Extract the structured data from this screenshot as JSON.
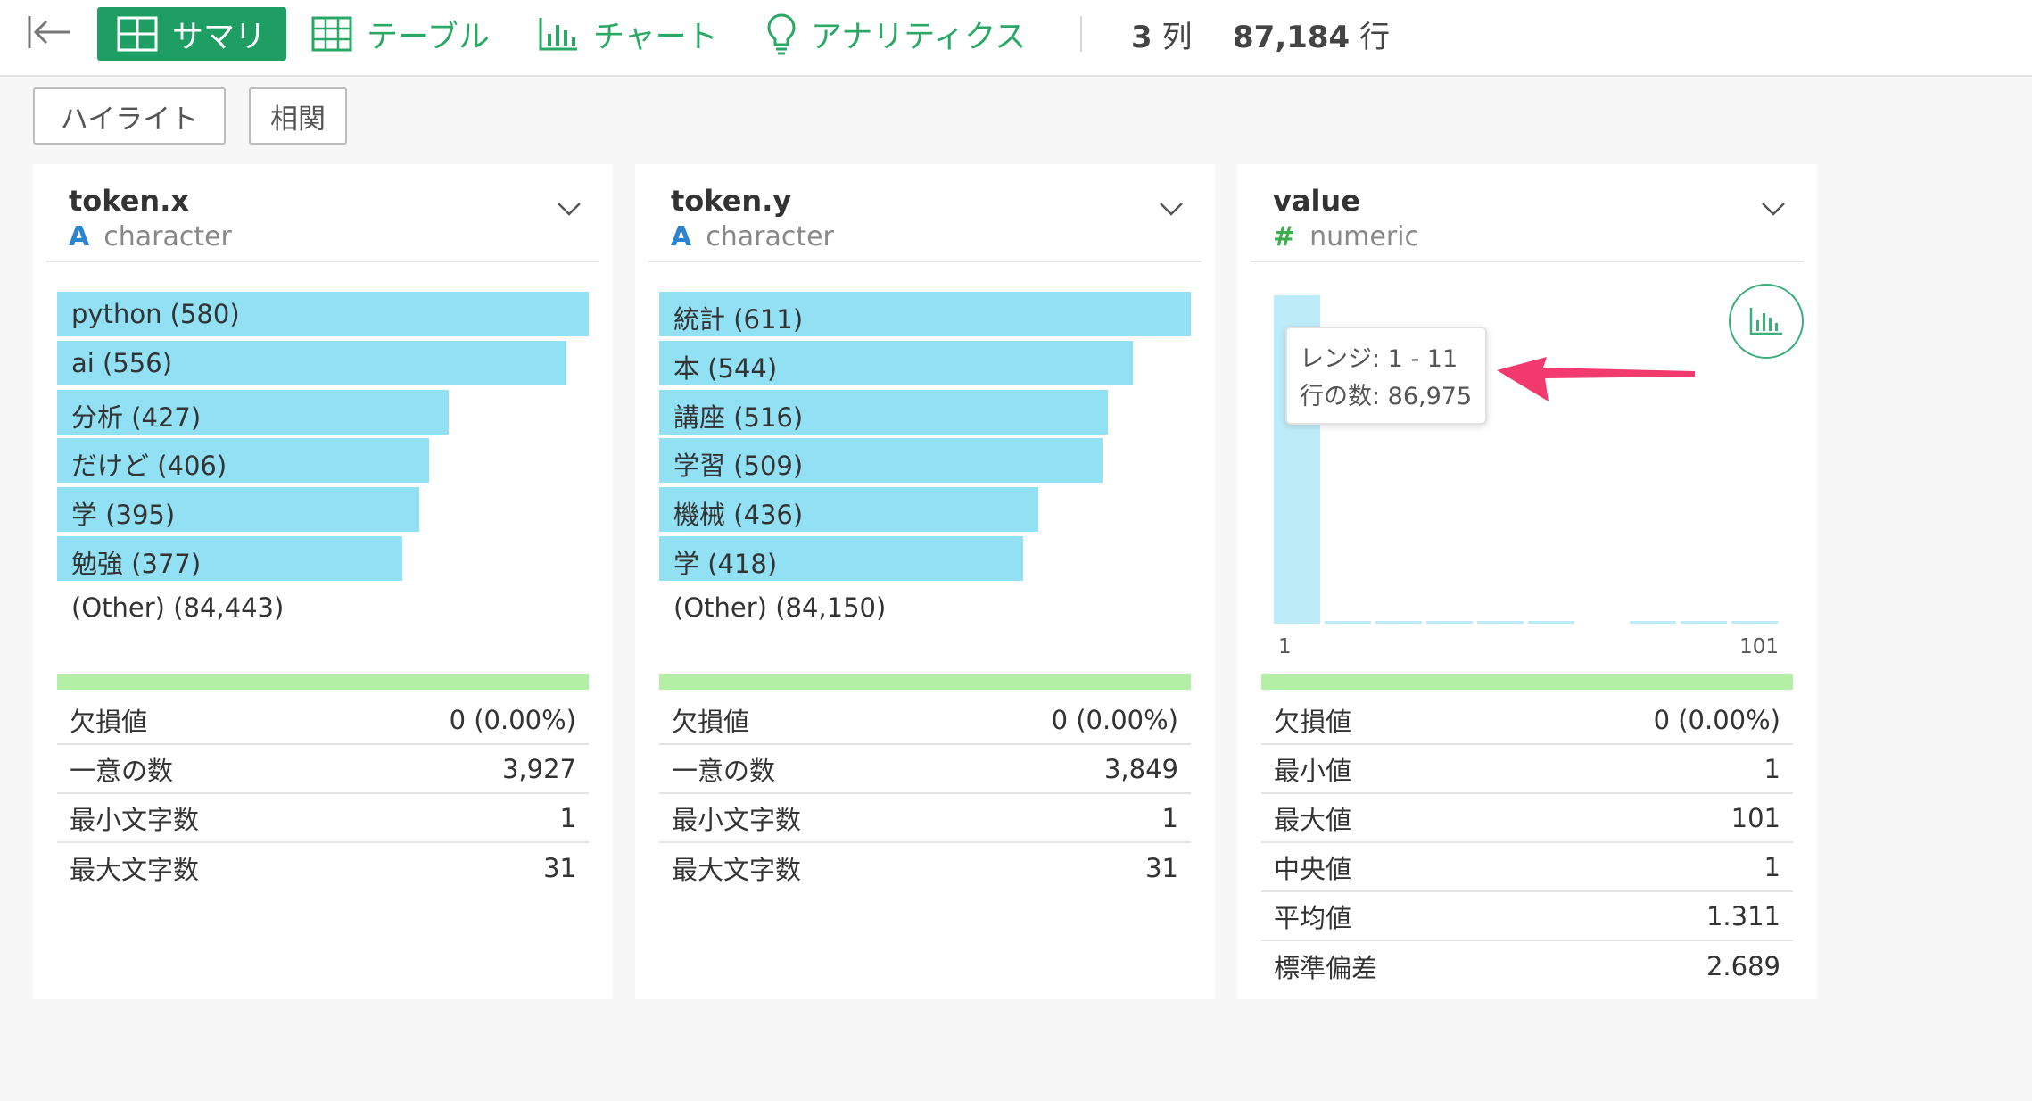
{
  "toolbar": {
    "tabs": [
      {
        "label": "サマリ",
        "icon": "grid-icon",
        "active": true
      },
      {
        "label": "テーブル",
        "icon": "table-icon",
        "active": false
      },
      {
        "label": "チャート",
        "icon": "bar-chart-icon",
        "active": false
      },
      {
        "label": "アナリティクス",
        "icon": "lightbulb-icon",
        "active": false
      }
    ],
    "columns_count": "3",
    "columns_unit": "列",
    "rows_count": "87,184",
    "rows_unit": "行"
  },
  "buttons": {
    "highlight": "ハイライト",
    "correlation": "相関"
  },
  "colors": {
    "accent_green": "#1f9e63",
    "bar_cyan": "#92e0f4",
    "strip_green": "#b3f0a6",
    "arrow_pink": "#f23a6f",
    "char_icon_blue": "#2a84d2",
    "numeric_icon_green": "#3cae4e"
  },
  "cards": [
    {
      "name": "token.x",
      "type_icon": "A",
      "type": "character",
      "bars": [
        {
          "label": "python (580)",
          "value": 580
        },
        {
          "label": "ai (556)",
          "value": 556
        },
        {
          "label": "分析 (427)",
          "value": 427
        },
        {
          "label": "だけど (406)",
          "value": 406
        },
        {
          "label": "学 (395)",
          "value": 395
        },
        {
          "label": "勉強 (377)",
          "value": 377
        }
      ],
      "other": "(Other) (84,443)",
      "stats": [
        {
          "label": "欠損値",
          "value": "0 (0.00%)"
        },
        {
          "label": "一意の数",
          "value": "3,927"
        },
        {
          "label": "最小文字数",
          "value": "1"
        },
        {
          "label": "最大文字数",
          "value": "31"
        }
      ]
    },
    {
      "name": "token.y",
      "type_icon": "A",
      "type": "character",
      "bars": [
        {
          "label": "統計 (611)",
          "value": 611
        },
        {
          "label": "本 (544)",
          "value": 544
        },
        {
          "label": "講座 (516)",
          "value": 516
        },
        {
          "label": "学習 (509)",
          "value": 509
        },
        {
          "label": "機械 (436)",
          "value": 436
        },
        {
          "label": "学 (418)",
          "value": 418
        }
      ],
      "other": "(Other) (84,150)",
      "stats": [
        {
          "label": "欠損値",
          "value": "0 (0.00%)"
        },
        {
          "label": "一意の数",
          "value": "3,849"
        },
        {
          "label": "最小文字数",
          "value": "1"
        },
        {
          "label": "最大文字数",
          "value": "31"
        }
      ]
    },
    {
      "name": "value",
      "type_icon": "#",
      "type": "numeric",
      "histogram": {
        "axis_min": "1",
        "axis_max": "101",
        "bins": [
          86975,
          60,
          45,
          35,
          30,
          25,
          0,
          20,
          15,
          10
        ]
      },
      "tooltip": {
        "range": "レンジ: 1 - 11",
        "count": "行の数: 86,975"
      },
      "stats": [
        {
          "label": "欠損値",
          "value": "0 (0.00%)"
        },
        {
          "label": "最小値",
          "value": "1"
        },
        {
          "label": "最大値",
          "value": "101"
        },
        {
          "label": "中央値",
          "value": "1"
        },
        {
          "label": "平均値",
          "value": "1.311"
        },
        {
          "label": "標準偏差",
          "value": "2.689"
        }
      ]
    }
  ]
}
